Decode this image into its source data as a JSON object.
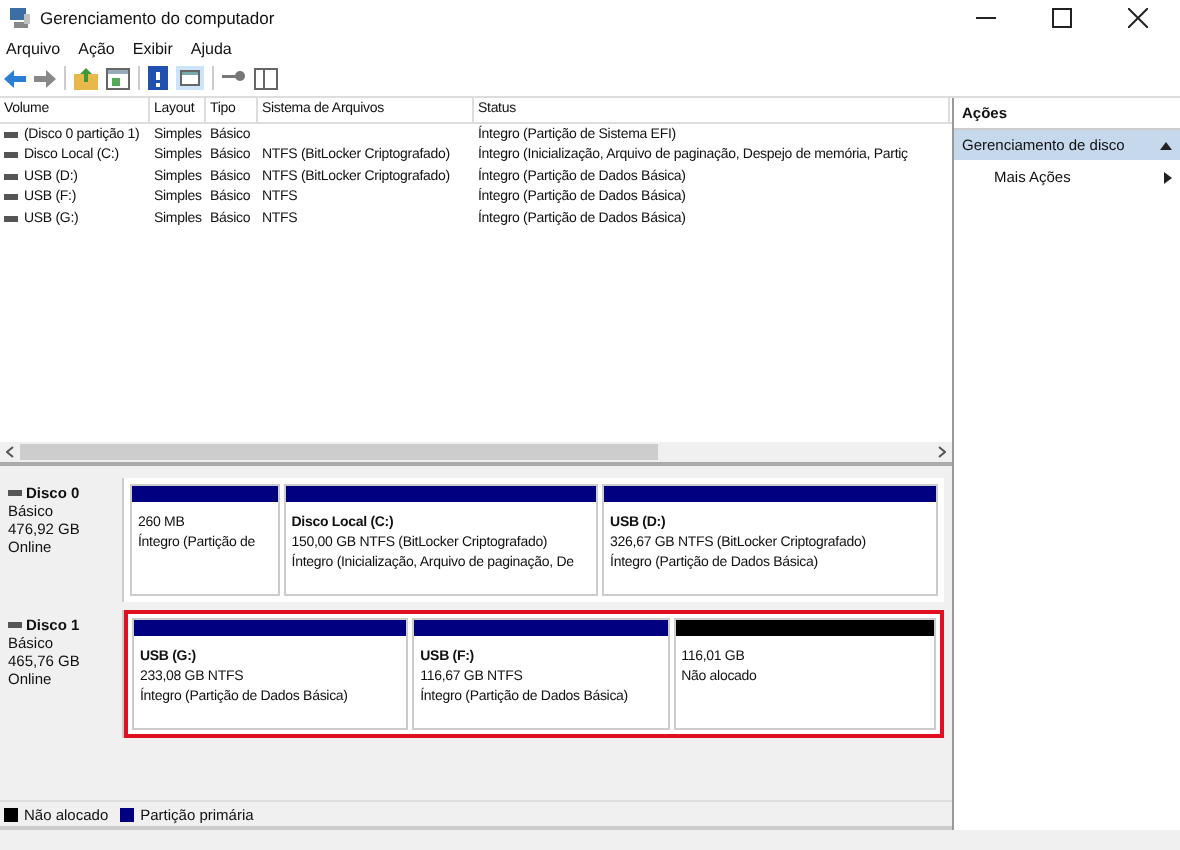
{
  "window": {
    "title": "Gerenciamento do computador"
  },
  "menu": [
    {
      "label": "Arquivo"
    },
    {
      "label": "Ação"
    },
    {
      "label": "Exibir"
    },
    {
      "label": "Ajuda"
    }
  ],
  "volumes": {
    "columns": [
      "Volume",
      "Layout",
      "Tipo",
      "Sistema de Arquivos",
      "Status"
    ],
    "rows": [
      {
        "volume": "(Disco 0 partição 1)",
        "layout": "Simples",
        "type": "Básico",
        "status": "Íntegro (Partição de Sistema EFI)"
      },
      {
        "volume": "Disco Local (C:)",
        "layout": "Simples",
        "type": "Básico",
        "filesystem": "NTFS (BitLocker Criptografado)",
        "status": "Íntegro (Inicialização, Arquivo de paginação, Despejo de memória, Partiç"
      },
      {
        "volume": "USB (D:)",
        "layout": "Simples",
        "type": "Básico",
        "filesystem": "NTFS (BitLocker Criptografado)",
        "status": "Íntegro (Partição de Dados Básica)"
      },
      {
        "volume": "USB (F:)",
        "layout": "Simples",
        "type": "Básico",
        "filesystem": "NTFS",
        "status": "Íntegro (Partição de Dados Básica)"
      },
      {
        "volume": "USB (G:)",
        "layout": "Simples",
        "type": "Básico",
        "filesystem": "NTFS",
        "status": "Íntegro (Partição de Dados Básica)"
      }
    ]
  },
  "disks": [
    {
      "name": "Disco 0",
      "type": "Básico",
      "size": "476,92 GB",
      "status": "Online",
      "highlighted": false,
      "partitions": [
        {
          "kind": "primary",
          "size": "260 MB",
          "status": "Íntegro (Partição de"
        },
        {
          "kind": "primary",
          "name": "Disco Local  (C:)",
          "size": "150,00 GB NTFS (BitLocker Criptografado)",
          "status": "Íntegro (Inicialização, Arquivo de paginação, De"
        },
        {
          "kind": "primary",
          "name": "USB  (D:)",
          "size": "326,67 GB NTFS (BitLocker Criptografado)",
          "status": "Íntegro (Partição de Dados Básica)"
        }
      ]
    },
    {
      "name": "Disco 1",
      "type": "Básico",
      "size": "465,76 GB",
      "status": "Online",
      "highlighted": true,
      "partitions": [
        {
          "kind": "primary",
          "name": "USB  (G:)",
          "size": "233,08 GB NTFS",
          "status": "Íntegro (Partição de Dados Básica)"
        },
        {
          "kind": "primary",
          "name": "USB  (F:)",
          "size": "116,67 GB NTFS",
          "status": "Íntegro (Partição de Dados Básica)"
        },
        {
          "kind": "unallocated",
          "size": "116,01 GB",
          "status": "Não alocado"
        }
      ]
    }
  ],
  "legend": [
    {
      "label": "Não alocado",
      "color": "#000000"
    },
    {
      "label": "Partição primária",
      "color": "#000080"
    }
  ],
  "actions": {
    "title": "Ações",
    "items": [
      {
        "kind": "header",
        "label": "Gerenciamento de disco"
      },
      {
        "kind": "submenu",
        "label": "Mais Ações"
      }
    ]
  }
}
